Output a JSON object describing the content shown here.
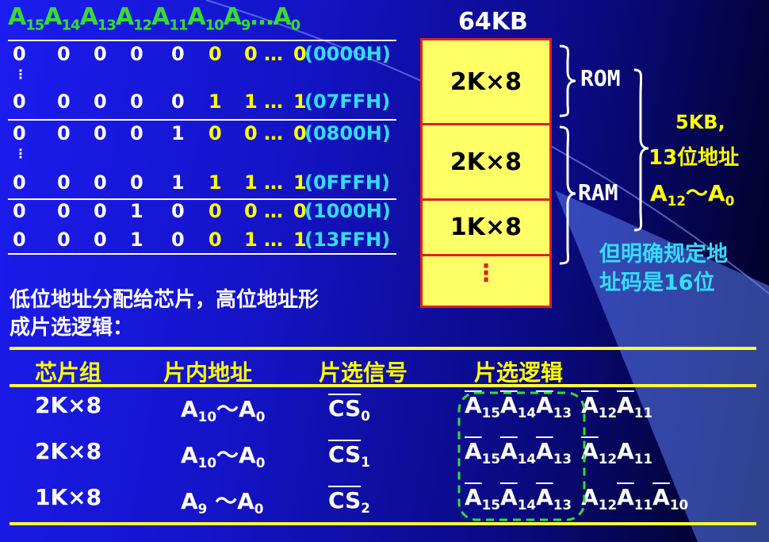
{
  "address_header": {
    "a15": "A",
    "s15": "15",
    "a14": "A",
    "s14": "14",
    "a13": "A",
    "s13": "13",
    "a12": "A",
    "s12": "12",
    "a11": "A",
    "s11": "11",
    "a10": "A",
    "s10": "10",
    "a9": "A",
    "s9": "9",
    "dots": "…",
    "a0": "A",
    "s0": "0"
  },
  "address_rows": [
    {
      "bits": [
        "0",
        "0",
        "0",
        "0",
        "0"
      ],
      "y1": "0",
      "y2": "0 …",
      "y3": "0",
      "hex": "(0000H)"
    },
    {
      "bits": [
        "0",
        "0",
        "0",
        "0",
        "0"
      ],
      "y1": "1",
      "y2": "1 …",
      "y3": "1",
      "hex": "(07FFH)"
    },
    {
      "bits": [
        "0",
        "0",
        "0",
        "0",
        "1"
      ],
      "y1": "0",
      "y2": "0 …",
      "y3": "0",
      "hex": "(0800H)"
    },
    {
      "bits": [
        "0",
        "0",
        "0",
        "0",
        "1"
      ],
      "y1": "1",
      "y2": "1 …",
      "y3": "1",
      "hex": "(0FFFH)"
    },
    {
      "bits": [
        "0",
        "0",
        "0",
        "1",
        "0"
      ],
      "y1": "0",
      "y2": "0 …",
      "y3": "0",
      "hex": "(1000H)"
    },
    {
      "bits": [
        "0",
        "0",
        "0",
        "1",
        "0"
      ],
      "y1": "0",
      "y2": "1 …",
      "y3": "1",
      "hex": "(13FFH)"
    }
  ],
  "vertical_ellipsis": "⋮",
  "memory_map": {
    "title": "64KB",
    "blocks": [
      "2K×8",
      "2K×8",
      "1K×8"
    ],
    "more": "⋮",
    "rom_label": "ROM",
    "ram_label": "RAM"
  },
  "annotation": {
    "line1": "5KB,",
    "line2": "13位地址",
    "range_a": "A",
    "range_s1": "12",
    "range_tilde": "～",
    "range_b": "A",
    "range_s2": "0",
    "note1": "但明确规定地",
    "note2": "址码是16位"
  },
  "paragraph": {
    "line1": "低位地址分配给芯片，高位地址形",
    "line2": "成片选逻辑："
  },
  "table": {
    "headers": [
      "芯片组",
      "片内地址",
      "片选信号",
      "片选逻辑"
    ],
    "rows": [
      {
        "chip": "2K×8",
        "addr_a": "A",
        "addr_s": "10",
        "tilde": "～",
        "addr_b": "A",
        "addr_s2": "0",
        "cs": "CS",
        "cs_sub": "0",
        "logic": [
          {
            "t": "A",
            "s": "15",
            "bar": true
          },
          {
            "t": "A",
            "s": "14",
            "bar": true
          },
          {
            "t": "A",
            "s": "13",
            "bar": true
          },
          {
            "t": "A",
            "s": "12",
            "bar": true
          },
          {
            "t": "A",
            "s": "11",
            "bar": true
          }
        ]
      },
      {
        "chip": "2K×8",
        "addr_a": "A",
        "addr_s": "10",
        "tilde": "～",
        "addr_b": "A",
        "addr_s2": "0",
        "cs": "CS",
        "cs_sub": "1",
        "logic": [
          {
            "t": "A",
            "s": "15",
            "bar": true
          },
          {
            "t": "A",
            "s": "14",
            "bar": true
          },
          {
            "t": "A",
            "s": "13",
            "bar": true
          },
          {
            "t": "A",
            "s": "12",
            "bar": true
          },
          {
            "t": "A",
            "s": "11",
            "bar": false
          }
        ]
      },
      {
        "chip": "1K×8",
        "addr_a": "A",
        "addr_s": "9",
        "tilde": " ～",
        "addr_b": "A",
        "addr_s2": "0",
        "cs": "CS",
        "cs_sub": "2",
        "logic": [
          {
            "t": "A",
            "s": "15",
            "bar": true
          },
          {
            "t": "A",
            "s": "14",
            "bar": true
          },
          {
            "t": "A",
            "s": "13",
            "bar": true
          },
          {
            "t": "A",
            "s": "12",
            "bar": false
          },
          {
            "t": "A",
            "s": "11",
            "bar": true
          },
          {
            "t": "A",
            "s": "10",
            "bar": true
          }
        ]
      }
    ]
  },
  "colors": {
    "bits": "#ffffff",
    "yellow": "#ffff00",
    "hex": "#33ddff",
    "header": "#33dd33",
    "box": "#ffff66",
    "box_border": "#e02020",
    "dash": "#33dd33"
  }
}
